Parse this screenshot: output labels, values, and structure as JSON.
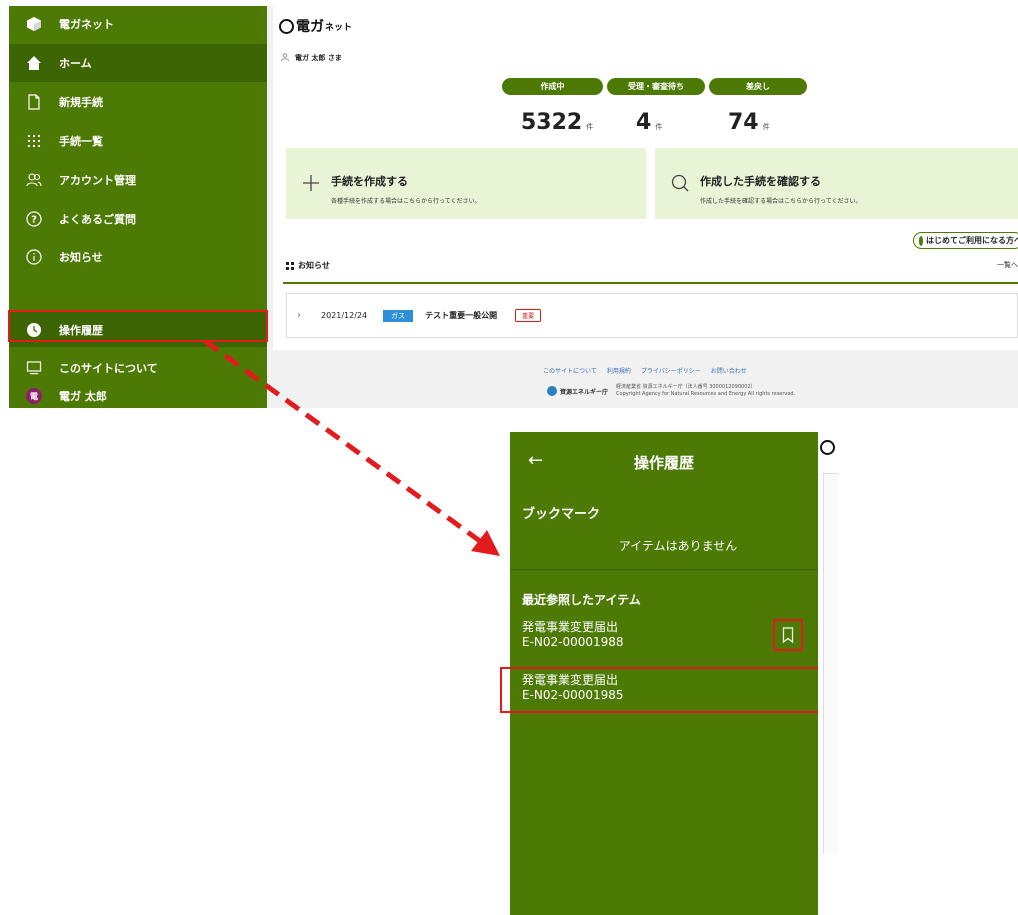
{
  "sidebar": {
    "brand": "電ガネット",
    "items": [
      {
        "label": "ホーム"
      },
      {
        "label": "新規手続"
      },
      {
        "label": "手続一覧"
      },
      {
        "label": "アカウント管理"
      },
      {
        "label": "よくあるご質問"
      },
      {
        "label": "お知らせ"
      }
    ],
    "history_label": "操作履歴",
    "about_label": "このサイトについて",
    "user_label": "電ガ 太郎",
    "avatar_char": "電"
  },
  "header": {
    "logo_main": "電ガ",
    "logo_small": "ネット",
    "user_greeting": "電ガ 太郎 さま"
  },
  "status": {
    "draft": {
      "label": "作成中",
      "value": "5322",
      "unit": "件"
    },
    "waiting": {
      "label": "受理・審査待ち",
      "value": "4",
      "unit": "件"
    },
    "returned": {
      "label": "差戻し",
      "value": "74",
      "unit": "件"
    }
  },
  "cards": {
    "create": {
      "title": "手続を作成する",
      "desc": "各種手続を作成する場合はこちらから行ってください。"
    },
    "confirm": {
      "title": "作成した手続を確認する",
      "desc": "作成した手続を確認する場合はこちらから行ってください。"
    }
  },
  "first_use_label": "はじめてご利用になる方へ",
  "news": {
    "heading": "お知らせ",
    "all_link": "一覧へ",
    "items": [
      {
        "date": "2021/12/24",
        "tag": "ガス",
        "title": "テスト重要一般公開",
        "badge": "重要"
      }
    ]
  },
  "footer": {
    "links": [
      "このサイトについて",
      "利用規約",
      "プライバシーポリシー",
      "お問い合わせ"
    ],
    "agency": "資源エネルギー庁",
    "copy_line1": "経済産業省 資源エネルギー庁（法人番号 3000012090002）",
    "copy_line2": "Copyright Agency for Natural Resources and Energy All rights reserved."
  },
  "history_panel": {
    "back_glyph": "←",
    "title": "操作履歴",
    "bookmark_heading": "ブックマーク",
    "bookmark_empty": "アイテムはありません",
    "recent_heading": "最近参照したアイテム",
    "recent_items": [
      {
        "name": "発電事業変更届出",
        "code": "E-N02-00001988"
      },
      {
        "name": "発電事業変更届出",
        "code": "E-N02-00001985"
      }
    ]
  },
  "colors": {
    "sidebar_green": "#4c7a05",
    "sidebar_active": "#3e6504",
    "card_green": "#e9f4d7",
    "highlight_red": "#e21c1c",
    "tag_blue": "#2f8fd6"
  }
}
